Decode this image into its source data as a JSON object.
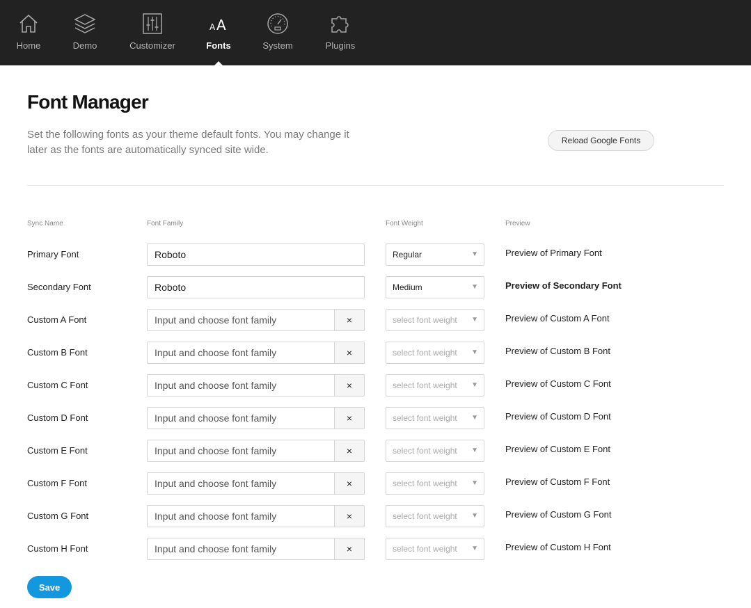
{
  "nav": {
    "items": [
      {
        "label": "Home",
        "icon": "home-icon"
      },
      {
        "label": "Demo",
        "icon": "layers-icon"
      },
      {
        "label": "Customizer",
        "icon": "sliders-icon"
      },
      {
        "label": "Fonts",
        "icon": "font-size-icon",
        "active": true
      },
      {
        "label": "System",
        "icon": "gauge-icon"
      },
      {
        "label": "Plugins",
        "icon": "puzzle-icon"
      }
    ]
  },
  "header": {
    "title": "Font Manager",
    "description": "Set the following fonts as your theme default fonts. You may change it later as the fonts are automatically synced site wide.",
    "reload_label": "Reload Google Fonts"
  },
  "table": {
    "headers": {
      "sync_name": "Sync Name",
      "font_family": "Font Family",
      "font_weight": "Font Weight",
      "preview": "Preview"
    },
    "rows": [
      {
        "name": "Primary Font",
        "family_value": "Roboto",
        "family_placeholder": "",
        "weight": "Regular",
        "preview": "Preview of Primary Font"
      },
      {
        "name": "Secondary Font",
        "family_value": "Roboto",
        "family_placeholder": "",
        "weight": "Medium",
        "preview": "Preview of Secondary Font"
      },
      {
        "name": "Custom A Font",
        "family_value": "",
        "family_placeholder": "Input and choose font family",
        "weight": "select font weight",
        "preview": "Preview of Custom A Font"
      },
      {
        "name": "Custom B Font",
        "family_value": "",
        "family_placeholder": "Input and choose font family",
        "weight": "select font weight",
        "preview": "Preview of Custom B Font"
      },
      {
        "name": "Custom C Font",
        "family_value": "",
        "family_placeholder": "Input and choose font family",
        "weight": "select font weight",
        "preview": "Preview of Custom C Font"
      },
      {
        "name": "Custom D Font",
        "family_value": "",
        "family_placeholder": "Input and choose font family",
        "weight": "select font weight",
        "preview": "Preview of Custom D Font"
      },
      {
        "name": "Custom E Font",
        "family_value": "",
        "family_placeholder": "Input and choose font family",
        "weight": "select font weight",
        "preview": "Preview of Custom E Font"
      },
      {
        "name": "Custom F Font",
        "family_value": "",
        "family_placeholder": "Input and choose font family",
        "weight": "select font weight",
        "preview": "Preview of Custom F Font"
      },
      {
        "name": "Custom G Font",
        "family_value": "",
        "family_placeholder": "Input and choose font family",
        "weight": "select font weight",
        "preview": "Preview of Custom G Font"
      },
      {
        "name": "Custom H Font",
        "family_value": "",
        "family_placeholder": "Input and choose font family",
        "weight": "select font weight",
        "preview": "Preview of Custom H Font"
      }
    ],
    "clear_glyph": "×",
    "dropdown_glyph": "▼"
  },
  "save_label": "Save",
  "colors": {
    "nav_bg": "#222222",
    "accent": "#1398e0"
  }
}
